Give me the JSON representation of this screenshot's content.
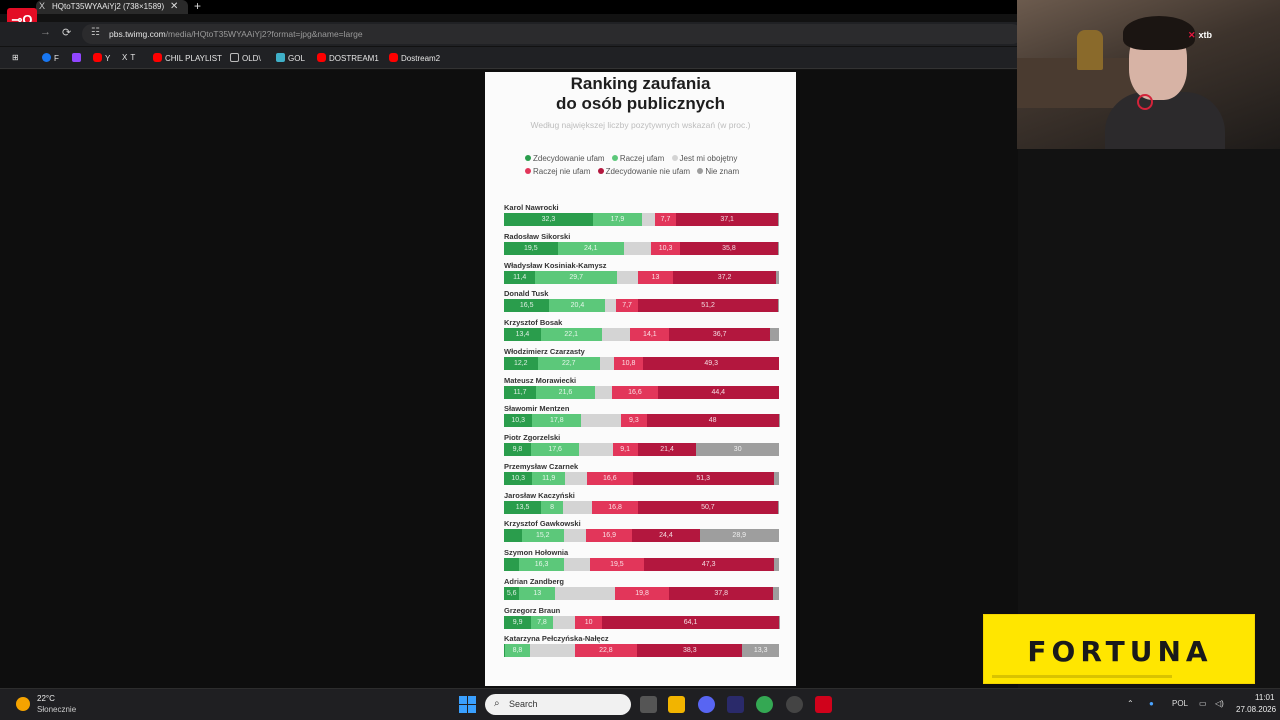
{
  "browser": {
    "tab_title": "HQtoT35WYAAiYj2 (738×1589)",
    "tab_close": "✕",
    "new_tab": "+",
    "url_host": "pbs.twimg.com",
    "url_path": "/media/HQtoT35WYAAiYj2?format=jpg&name=large"
  },
  "bookmarks": [
    {
      "label": "F",
      "color": "#1877f2"
    },
    {
      "label": "",
      "color": "#9146ff"
    },
    {
      "label": "Y",
      "color": "#ff0000"
    },
    {
      "label": "T",
      "color": "#ffffff"
    },
    {
      "label": "CHIL PLAYLIST",
      "color": "#ff0000"
    },
    {
      "label": "OLD\\",
      "color": "#bbbbbb"
    },
    {
      "label": "GOL",
      "color": "#3fb0c8"
    },
    {
      "label": "DOSTREAM1",
      "color": "#ff0000"
    },
    {
      "label": "Dostream2",
      "color": "#ff0000"
    }
  ],
  "infographic": {
    "title_line1": "Ranking zaufania",
    "title_line2": "do osób publicznych",
    "subtitle": "Według największej liczby pozytywnych wskazań (w proc.)",
    "legend_row1": [
      {
        "label": "Zdecydowanie ufam",
        "color": "#2a9d4c"
      },
      {
        "label": "Raczej ufam",
        "color": "#5cc87a"
      },
      {
        "label": "Jest mi obojętny",
        "color": "#d4d4d4"
      }
    ],
    "legend_row2": [
      {
        "label": "Raczej nie ufam",
        "color": "#e2365a"
      },
      {
        "label": "Zdecydowanie nie ufam",
        "color": "#b3173e"
      },
      {
        "label": "Nie znam",
        "color": "#9e9e9e"
      }
    ],
    "colors": [
      "#2a9d4c",
      "#5cc87a",
      "#d4d4d4",
      "#e2365a",
      "#b3173e",
      "#9e9e9e"
    ]
  },
  "chart_data": {
    "type": "bar",
    "stacked": true,
    "orientation": "horizontal",
    "title": "Ranking zaufania do osób publicznych",
    "subtitle": "Według największej liczby pozytywnych wskazań (w proc.)",
    "series_names": [
      "Zdecydowanie ufam",
      "Raczej ufam",
      "Jest mi obojętny",
      "Raczej nie ufam",
      "Zdecydowanie nie ufam",
      "Nie znam"
    ],
    "rows": [
      {
        "name": "Karol Nawrocki",
        "values": [
          32.3,
          17.9,
          4.7,
          7.7,
          37.1,
          0.3
        ],
        "labels": [
          "32,3",
          "17,9",
          "",
          "7,7",
          "37,1",
          ""
        ]
      },
      {
        "name": "Radosław Sikorski",
        "values": [
          19.5,
          24.1,
          10.0,
          10.3,
          35.8,
          0.3
        ],
        "labels": [
          "19,5",
          "24,1",
          "",
          "10,3",
          "35,8",
          ""
        ]
      },
      {
        "name": "Władysław Kosiniak-Kamysz",
        "values": [
          11.4,
          29.7,
          7.5,
          13.0,
          37.2,
          1.2
        ],
        "labels": [
          "11,4",
          "29,7",
          "",
          "13",
          "37,2",
          ""
        ]
      },
      {
        "name": "Donald Tusk",
        "values": [
          16.5,
          20.4,
          4.0,
          7.7,
          51.2,
          0.2
        ],
        "labels": [
          "16,5",
          "20,4",
          "",
          "7,7",
          "51,2",
          ""
        ]
      },
      {
        "name": "Krzysztof Bosak",
        "values": [
          13.4,
          22.1,
          10.5,
          14.1,
          36.7,
          3.2
        ],
        "labels": [
          "13,4",
          "22,1",
          "",
          "14,1",
          "36,7",
          ""
        ]
      },
      {
        "name": "Włodzimierz Czarzasty",
        "values": [
          12.2,
          22.7,
          5.0,
          10.8,
          49.3,
          0.0
        ],
        "labels": [
          "12,2",
          "22,7",
          "",
          "10,8",
          "49,3",
          ""
        ]
      },
      {
        "name": "Mateusz Morawiecki",
        "values": [
          11.7,
          21.6,
          6.3,
          16.6,
          44.4,
          0.0
        ],
        "labels": [
          "11,7",
          "21,6",
          "",
          "16,6",
          "44,4",
          ""
        ]
      },
      {
        "name": "Sławomir Mentzen",
        "values": [
          10.3,
          17.8,
          14.5,
          9.3,
          48.0,
          0.1
        ],
        "labels": [
          "10,3",
          "17,8",
          "",
          "9,3",
          "48",
          ""
        ]
      },
      {
        "name": "Piotr Zgorzelski",
        "values": [
          9.8,
          17.6,
          12.1,
          9.1,
          21.4,
          30.0
        ],
        "labels": [
          "9,8",
          "17,6",
          "",
          "9,1",
          "21,4",
          "30"
        ]
      },
      {
        "name": "Przemysław Czarnek",
        "values": [
          10.3,
          11.9,
          8.0,
          16.6,
          51.3,
          1.9
        ],
        "labels": [
          "10,3",
          "11,9",
          "",
          "16,6",
          "51,3",
          ""
        ]
      },
      {
        "name": "Jarosław Kaczyński",
        "values": [
          13.5,
          8.0,
          10.5,
          16.8,
          50.7,
          0.5
        ],
        "labels": [
          "13,5",
          "8",
          "",
          "16,8",
          "50,7",
          ""
        ]
      },
      {
        "name": "Krzysztof Gawkowski",
        "values": [
          6.5,
          15.2,
          8.1,
          16.9,
          24.4,
          28.9
        ],
        "labels": [
          "",
          "15,2",
          "",
          "16,9",
          "24,4",
          "28,9"
        ]
      },
      {
        "name": "Szymon Hołownia",
        "values": [
          5.5,
          16.3,
          9.5,
          19.5,
          47.3,
          1.9
        ],
        "labels": [
          "",
          "16,3",
          "",
          "19,5",
          "47,3",
          ""
        ]
      },
      {
        "name": "Adrian Zandberg",
        "values": [
          5.6,
          13.0,
          21.7,
          19.8,
          37.8,
          2.1
        ],
        "labels": [
          "5,6",
          "13",
          "",
          "19,8",
          "37,8",
          ""
        ]
      },
      {
        "name": "Grzegorz Braun",
        "values": [
          9.9,
          7.8,
          8.1,
          10.0,
          64.1,
          0.1
        ],
        "labels": [
          "9,9",
          "7,8",
          "",
          "10",
          "64,1",
          ""
        ]
      },
      {
        "name": "Katarzyna Pełczyńska-Nałęcz",
        "values": [
          0.5,
          8.8,
          16.4,
          22.8,
          38.3,
          13.3
        ],
        "labels": [
          "",
          "8,8",
          "",
          "22,8",
          "38,3",
          "13,3"
        ]
      }
    ]
  },
  "webcam": {
    "badge": "xtb",
    "badge_mark": "✕"
  },
  "banner": {
    "text": "FORTUNA"
  },
  "taskbar": {
    "temp": "22°C",
    "weather": "Słonecznie",
    "search_label": "Search",
    "lang": "POL",
    "time": "11:01",
    "date": "27.08.2026"
  }
}
